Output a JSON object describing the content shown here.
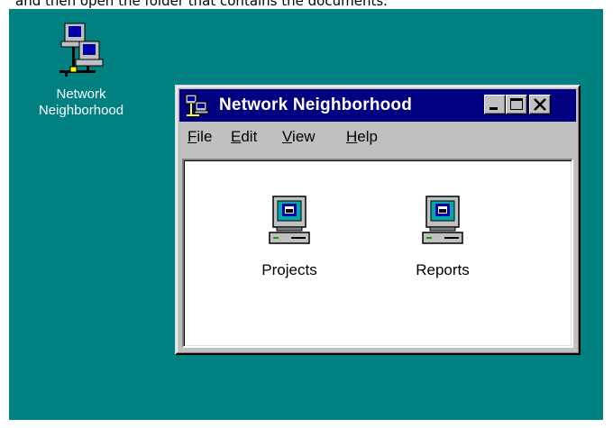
{
  "instruction_text": "and then open the folder that contains the documents.",
  "desktop": {
    "background_color": "#008080",
    "icons": [
      {
        "label": "Network\nNeighborhood",
        "icon": "network-neighborhood-icon"
      }
    ]
  },
  "window": {
    "title": "Network Neighborhood",
    "title_icon": "network-neighborhood-icon",
    "title_bar_color": "#000080",
    "controls": {
      "minimize": "minimize-icon",
      "maximize": "maximize-icon",
      "close": "close-icon"
    },
    "menu": [
      {
        "label": "File"
      },
      {
        "label": "Edit"
      },
      {
        "label": "View"
      },
      {
        "label": "Help"
      }
    ],
    "items": [
      {
        "label": "Projects",
        "icon": "computer-icon"
      },
      {
        "label": "Reports",
        "icon": "computer-icon"
      }
    ]
  }
}
